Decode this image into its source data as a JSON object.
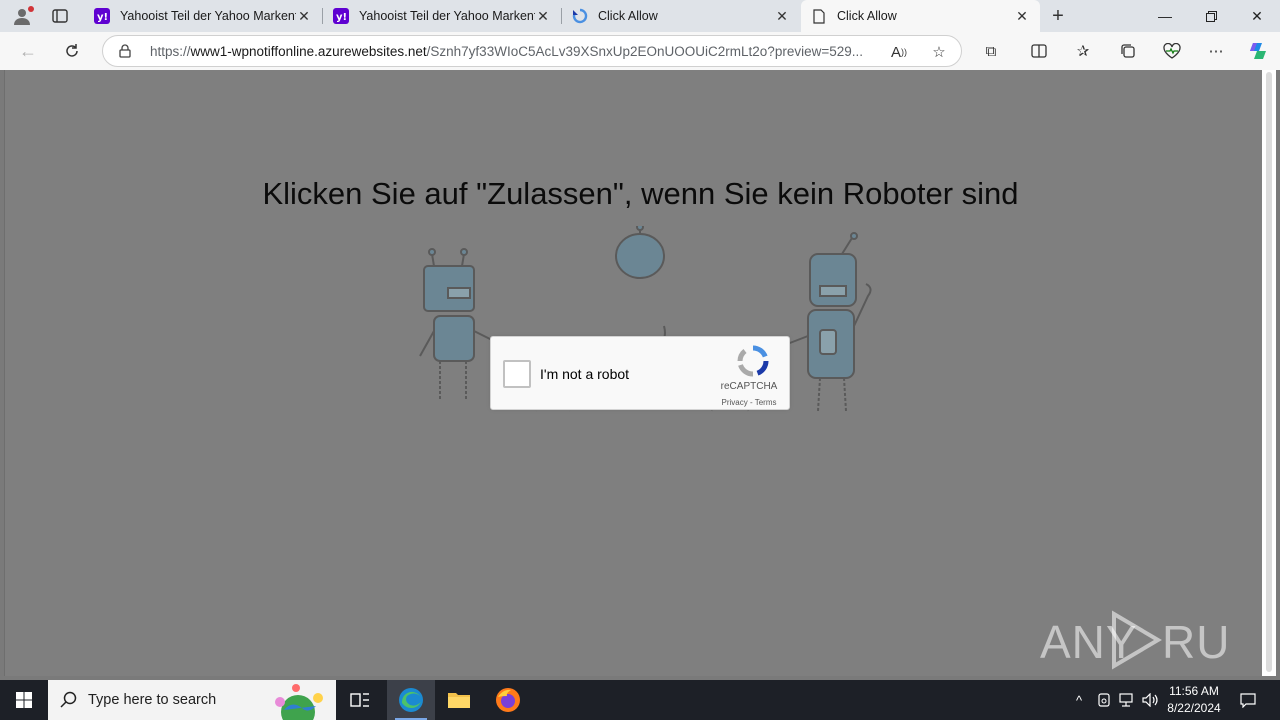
{
  "browser": {
    "tabs": [
      {
        "title": "Yahooist Teil der Yahoo Markenfa",
        "favicon": "yahoo-icon",
        "active": false
      },
      {
        "title": "Yahooist Teil der Yahoo Markenfa",
        "favicon": "yahoo-icon",
        "active": false
      },
      {
        "title": "Click Allow",
        "favicon": "recaptcha-icon",
        "active": false
      },
      {
        "title": "Click Allow",
        "favicon": "page-icon",
        "active": true
      }
    ],
    "url": {
      "scheme": "https://",
      "host": "www1-wpnotiffonline.azurewebsites.net",
      "path": "/Sznh7yf33WIoC5AcLv39XSnxUp2EOnUOOUiC2rmLt2o?preview=529..."
    },
    "accent": "#0078d4"
  },
  "page": {
    "headline": "Klicken Sie auf \"Zulassen\", wenn Sie kein Roboter sind",
    "background": "#7f7f7f",
    "captcha": {
      "label": "I'm not a robot",
      "brand": "reCAPTCHA",
      "links": "Privacy - Terms",
      "checked": false
    }
  },
  "watermark": "ANY RUN",
  "taskbar": {
    "search_placeholder": "Type here to search",
    "apps": [
      "task-view-icon",
      "edge-icon",
      "file-explorer-icon",
      "firefox-icon"
    ],
    "time": "11:56 AM",
    "date": "8/22/2024"
  }
}
